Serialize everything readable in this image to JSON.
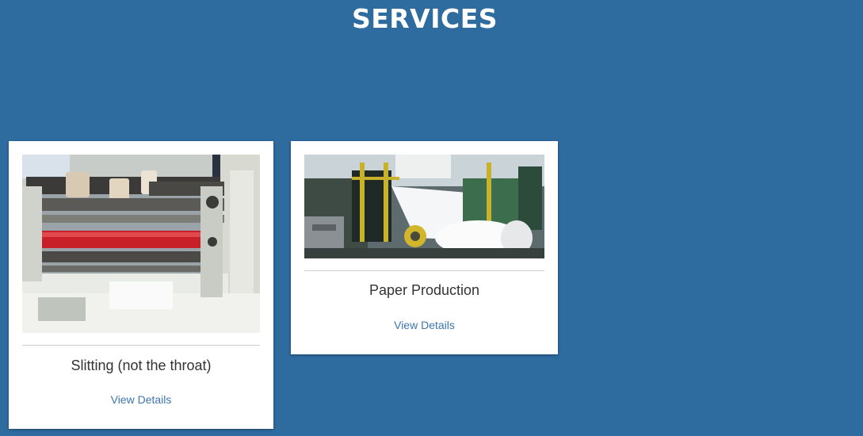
{
  "section": {
    "title": "SERVICES"
  },
  "services": [
    {
      "title": "Slitting (not the throat)",
      "link_label": "View Details"
    },
    {
      "title": "Paper Production",
      "link_label": "View Details"
    }
  ],
  "colors": {
    "background": "#2e6b9e",
    "card": "#ffffff",
    "link": "#3d76ad",
    "title_text": "#333333"
  }
}
